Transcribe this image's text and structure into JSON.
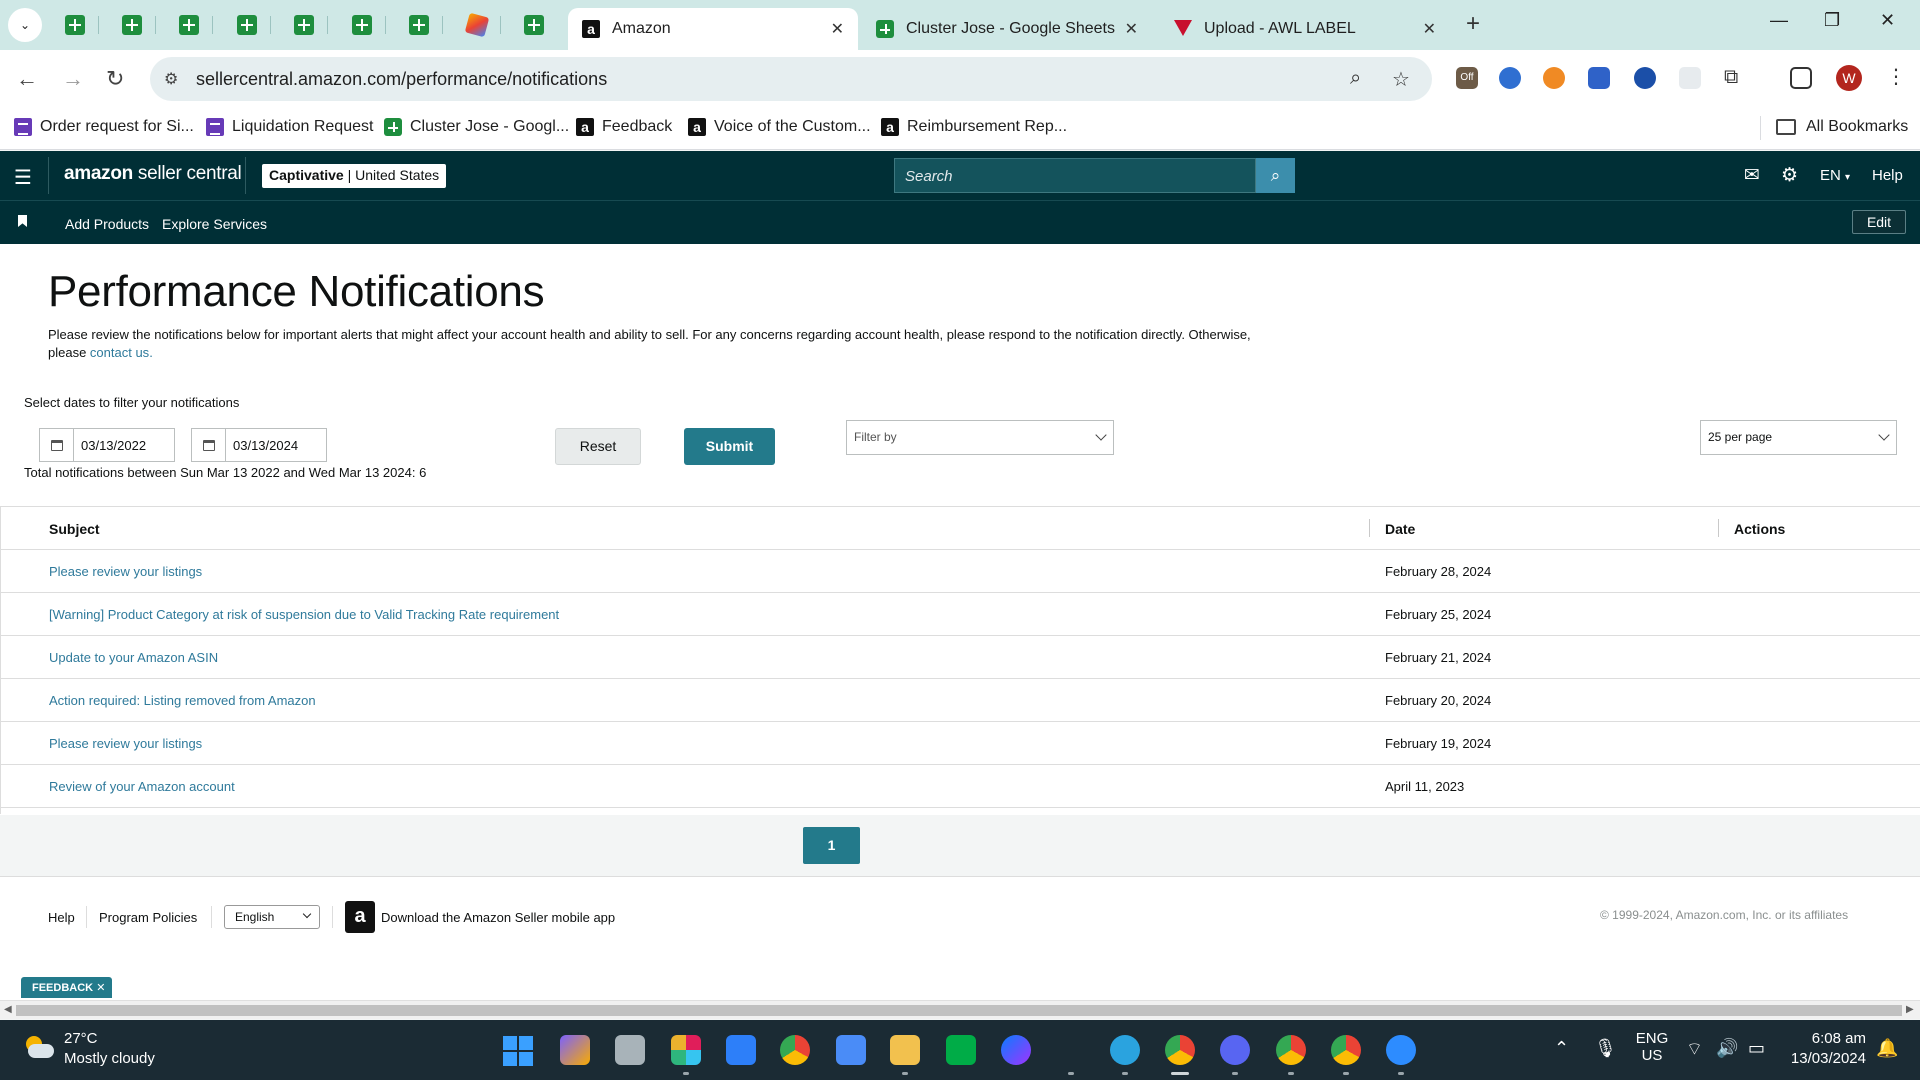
{
  "browser": {
    "tabs": [
      {
        "title": "Amazon",
        "icon": "amazon-icon",
        "active": true
      },
      {
        "title": "Cluster Jose - Google Sheets",
        "icon": "google-sheets-icon",
        "active": false
      },
      {
        "title": "Upload - AWL LABEL",
        "icon": "awl-label-icon",
        "active": false
      }
    ],
    "url": "sellercentral.amazon.com/performance/notifications",
    "bookmarks": [
      {
        "label": "Order request for Si..."
      },
      {
        "label": "Liquidation Request"
      },
      {
        "label": "Cluster Jose - Googl..."
      },
      {
        "label": "Feedback"
      },
      {
        "label": "Voice of the Custom..."
      },
      {
        "label": "Reimbursement Rep..."
      }
    ],
    "all_bookmarks": "All Bookmarks",
    "profile_initial": "W",
    "ext_badge": "Off"
  },
  "header": {
    "logo_bold": "amazon",
    "logo_rest": " seller central",
    "store_name": "Captivative",
    "store_region": " | United States",
    "search_placeholder": "Search",
    "language": "EN",
    "help": "Help"
  },
  "nav": {
    "links": [
      "Add Products",
      "Explore Services"
    ],
    "edit": "Edit"
  },
  "page": {
    "title": "Performance Notifications",
    "description": "Please review the notifications below for important alerts that might affect your account health and ability to sell. For any concerns regarding account health, please respond to the notification directly. Otherwise, please ",
    "contact_link": "contact us",
    "description_end": ".",
    "filter_label": "Select dates to filter your notifications",
    "start_date": "03/13/2022",
    "end_date": "03/13/2024",
    "total_text": "Total notifications between Sun Mar 13 2022 and Wed Mar 13 2024: 6",
    "reset": "Reset",
    "submit": "Submit",
    "filter_by": "Filter by",
    "per_page": "25 per page"
  },
  "table": {
    "headers": [
      "Subject",
      "Date",
      "Actions"
    ],
    "rows": [
      {
        "subject": "Please review your listings",
        "date": "February 28, 2024"
      },
      {
        "subject": "[Warning] Product Category at risk of suspension due to Valid Tracking Rate requirement",
        "date": "February 25, 2024"
      },
      {
        "subject": "Update to your Amazon ASIN",
        "date": "February 21, 2024"
      },
      {
        "subject": "Action required: Listing removed from Amazon",
        "date": "February 20, 2024"
      },
      {
        "subject": "Please review your listings",
        "date": "February 19, 2024"
      },
      {
        "subject": "Review of your Amazon account",
        "date": "April 11, 2023"
      }
    ]
  },
  "pagination": {
    "current": "1"
  },
  "footer": {
    "help": "Help",
    "policies": "Program Policies",
    "language": "English",
    "app_text": "Download the Amazon Seller mobile app",
    "copyright": "© 1999-2024, Amazon.com, Inc. or its affiliates"
  },
  "feedback": "FEEDBACK",
  "taskbar": {
    "temperature": "27°C",
    "weather": "Mostly cloudy",
    "lang_top": "ENG",
    "lang_bottom": "US",
    "time": "6:08 am",
    "date": "13/03/2024"
  }
}
